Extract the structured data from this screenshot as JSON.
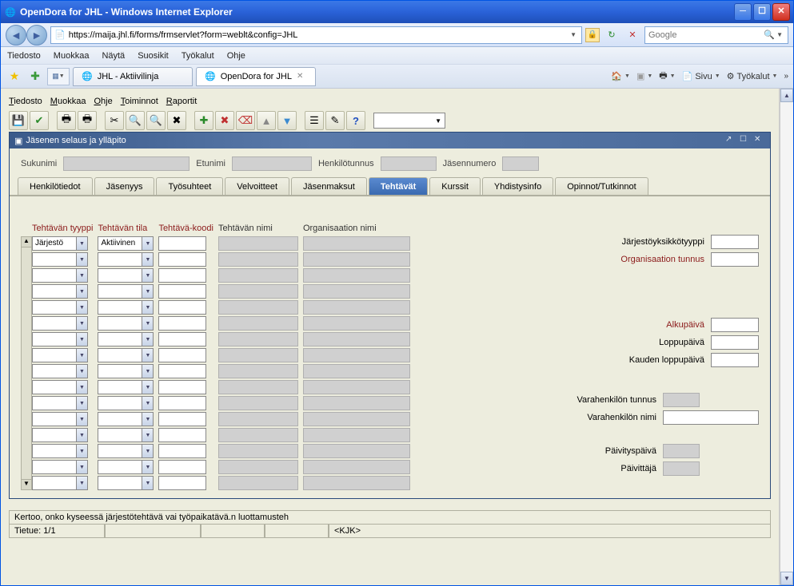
{
  "window": {
    "title": "OpenDora for JHL - Windows Internet Explorer"
  },
  "address_bar": {
    "url": "https://maija.jhl.fi/forms/frmservlet?form=weblt&config=JHL"
  },
  "search": {
    "placeholder": "Google"
  },
  "ie_menu": [
    "Tiedosto",
    "Muokkaa",
    "Näytä",
    "Suosikit",
    "Työkalut",
    "Ohje"
  ],
  "ie_tabs": [
    {
      "label": "JHL - Aktiivilinja",
      "active": false
    },
    {
      "label": "OpenDora for JHL",
      "active": true
    }
  ],
  "ie_right_tools": {
    "sivu": "Sivu",
    "tyokalut": "Työkalut"
  },
  "app_menu": [
    "Tiedosto",
    "Muokkaa",
    "Ohje",
    "Toiminnot",
    "Raportit"
  ],
  "inner_window": {
    "title": "Jäsenen selaus ja ylläpito"
  },
  "search_fields": {
    "sukunimi": "Sukunimi",
    "etunimi": "Etunimi",
    "henkilotunnus": "Henkilötunnus",
    "jasennumero": "Jäsennumero"
  },
  "tabs": [
    "Henkilötiedot",
    "Jäsenyys",
    "Työsuhteet",
    "Velvoitteet",
    "Jäsenmaksut",
    "Tehtävät",
    "Kurssit",
    "Yhdistysinfo",
    "Opinnot/Tutkinnot"
  ],
  "active_tab_index": 5,
  "grid": {
    "headers": {
      "tyyppi": "Tehtävän tyyppi",
      "tila": "Tehtävän tila",
      "koodi": "Tehtävä-koodi",
      "nimi": "Tehtävän nimi",
      "org": "Organisaation nimi"
    },
    "row0": {
      "tyyppi": "Järjestö",
      "tila": "Aktiivinen"
    },
    "row_count": 16
  },
  "right_fields": {
    "jarjestoyksikkotyyppi": "Järjestöyksikkötyyppi",
    "organisaation_tunnus": "Organisaation tunnus",
    "alkupaiva": "Alkupäivä",
    "loppupaiva": "Loppupäivä",
    "kauden_loppupaiva": "Kauden loppupäivä",
    "varahenkilon_tunnus": "Varahenkilön tunnus",
    "varahenkilon_nimi": "Varahenkilön nimi",
    "paivityspaiva": "Päivityspäivä",
    "paivittaja": "Päivittäjä"
  },
  "status": {
    "help": "Kertoo, onko kyseessä järjestötehtävä vai työpaikatävä.n luottamusteh",
    "record": "Tietue: 1/1",
    "user": "<KJK>"
  }
}
